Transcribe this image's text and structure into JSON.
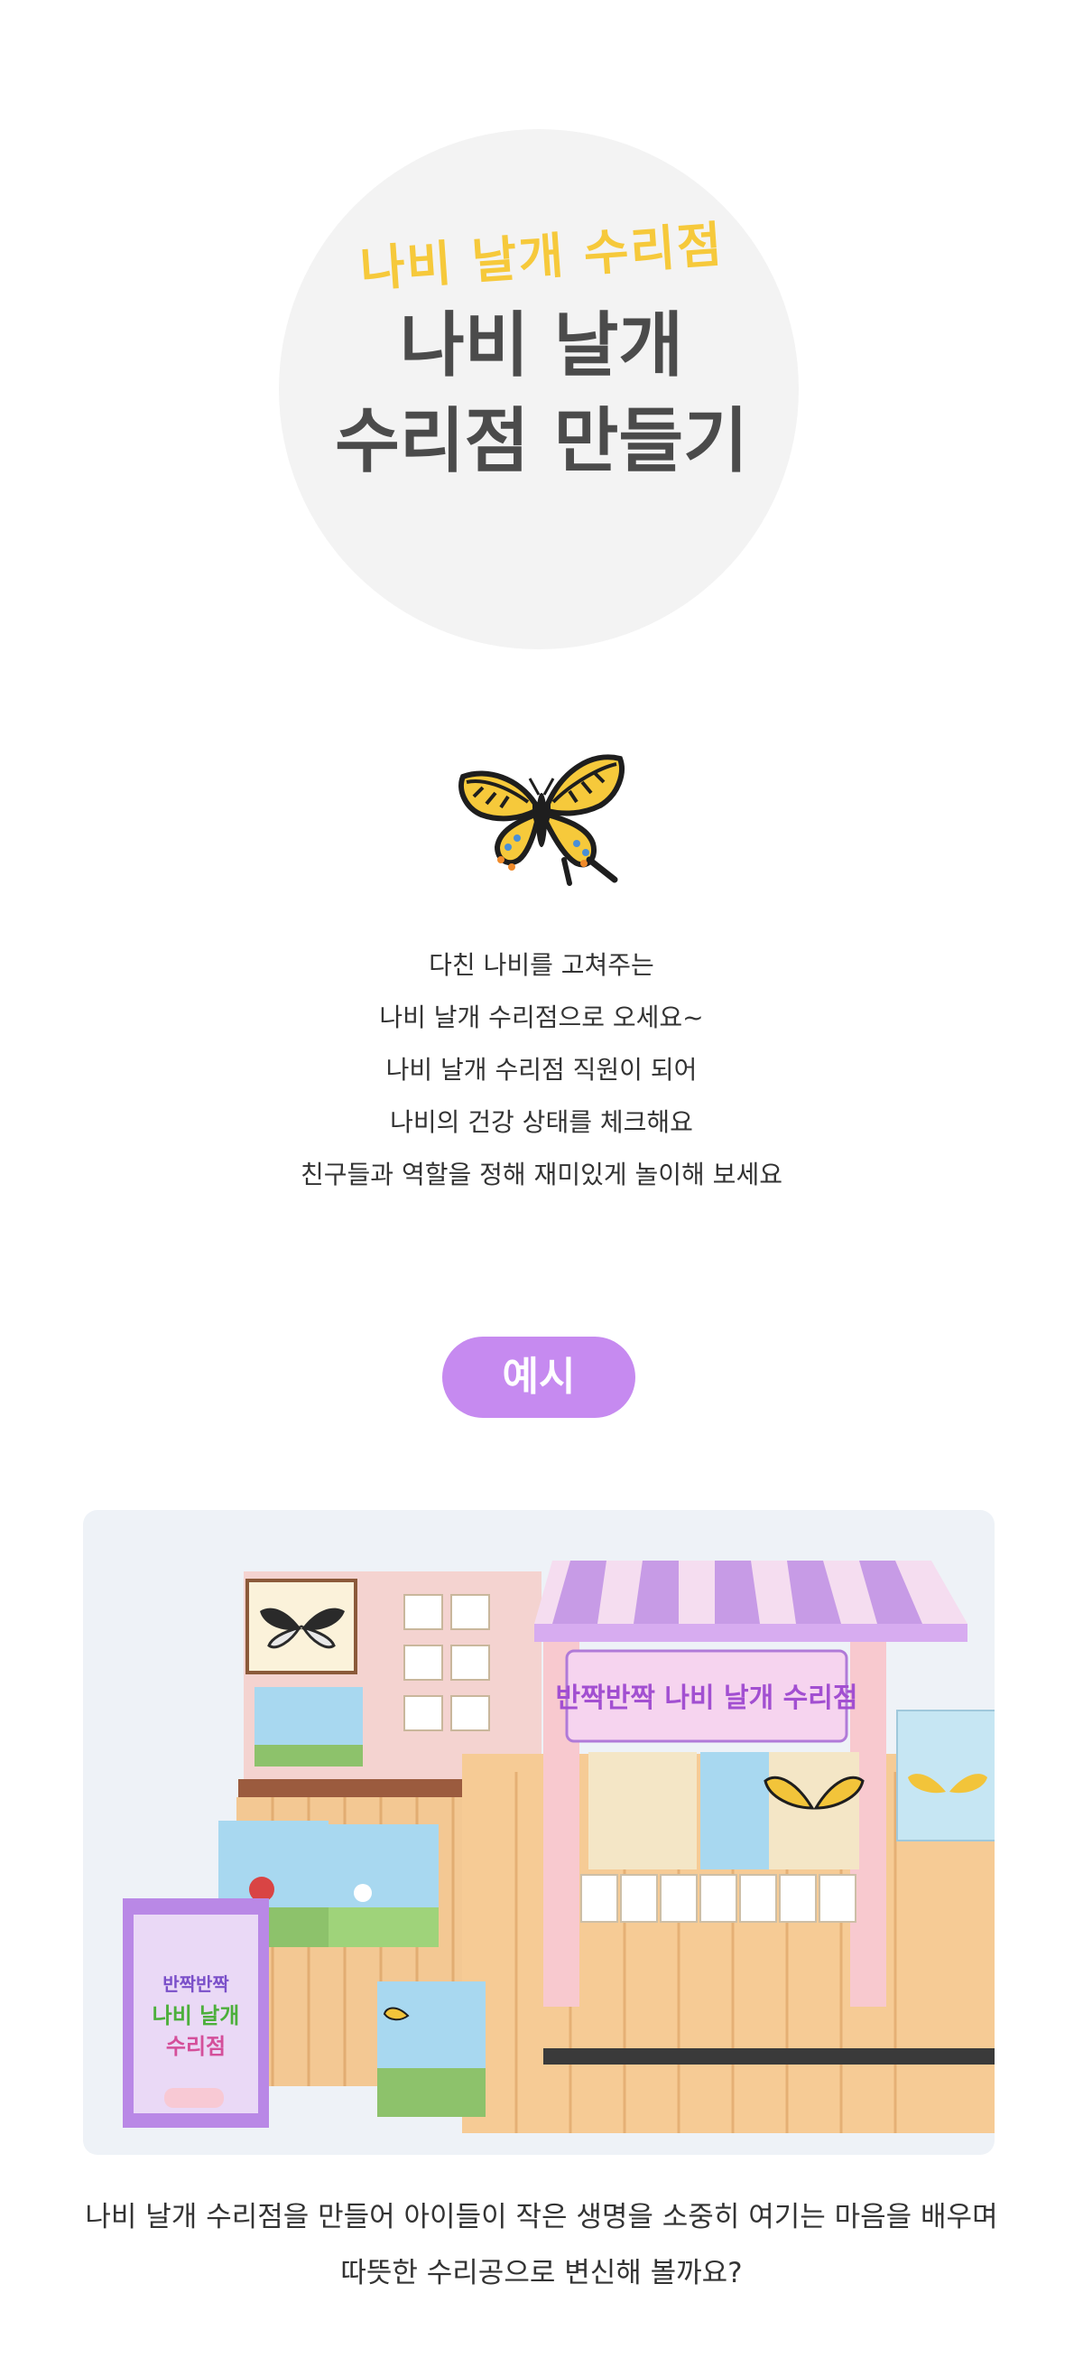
{
  "header": {
    "subtitle": "나비 날개 수리점",
    "title_line1": "나비 날개",
    "title_line2": "수리점 만들기"
  },
  "intro": {
    "icon": "swallowtail-butterfly-icon",
    "lines": [
      "다친 나비를 고쳐주는",
      "나비 날개 수리점으로 오세요~",
      "나비 날개 수리점 직원이 되어",
      "나비의 건강 상태를 체크해요",
      "친구들과 역할을 정해 재미있게 놀이해 보세요"
    ]
  },
  "example": {
    "badge_label": "예시",
    "photo": {
      "shop_sign": "반짝반짝 나비 날개 수리점",
      "board_sign_line1": "반짝반짝",
      "board_sign_line2": "나비 날개",
      "board_sign_line3": "수리점"
    },
    "caption_line1": "나비 날개 수리점을 만들어 아이들이 작은 생명을 소중히 여기는 마음을 배우며",
    "caption_line2": "따뜻한 수리공으로 변신해 볼까요?"
  },
  "colors": {
    "accent_yellow": "#f6c93b",
    "badge_purple": "#c68af0",
    "title_gray": "#4b4b4b"
  }
}
